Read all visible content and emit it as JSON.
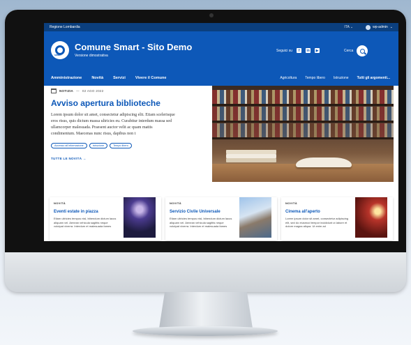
{
  "topbar": {
    "region": "Regione Lombardia",
    "lang": "ITA",
    "lang_caret": "⌄",
    "user": "wp-admin",
    "user_caret": "⌄"
  },
  "header": {
    "logo_word": "smart",
    "title": "Comune Smart - Sito Demo",
    "subtitle": "Versione dimostrativa",
    "follow": "Seguici su",
    "social": [
      "f",
      "in",
      "▶"
    ],
    "search_label": "Cerca"
  },
  "nav": {
    "primary": [
      "Amministrazione",
      "Novità",
      "Servizi",
      "Vivere il Comune"
    ],
    "secondary": [
      "Agricoltura",
      "Tempo libero",
      "Istruzione"
    ],
    "all_topics": "Tutti gli argomenti..."
  },
  "hero": {
    "kind": "NOTIZIA",
    "sep": "—",
    "date": "02 AGO 2022",
    "title": "Avviso apertura biblioteche",
    "lead": "Lorem ipsum dolor sit amet, consectetur adipiscing elit. Etiam scelerisque eros risus, quis dictum massa ultricies eu. Curabitur interdum massa sed ullamcorper malesuada. Praesent auctor velit ac quam mattis condimentum. Maecenas nunc risus, dapibus non t",
    "tags": [
      "Accesso all'informazione",
      "Istruzione",
      "Tempo libero"
    ],
    "all_news": "TUTTE LE NOVITÀ",
    "arrow": "→"
  },
  "cards": [
    {
      "kind": "NOVITÀ",
      "title": "Eventi estate in piazza",
      "text": "Etiam ultricies tempus nisl, bibendum dictum lacus aliquam vel. Aenean vehicula sagittis neque volutpat viverra. Interdum et malesuada fames"
    },
    {
      "kind": "NOVITÀ",
      "title": "Servizio Civile Universale",
      "text": "Etiam ultricies tempus nisl, bibendum dictum lacus aliquam vel. Aenean vehicula sagittis neque volutpat viverra. Interdum et malesuada fames"
    },
    {
      "kind": "NOVITÀ",
      "title": "Cinema all'aperto",
      "text": "Lorem ipsum dolor sit amet, consectetur adipiscing elit, sed do eiusmod tempor incididunt ut labore et dolore magna aliqua. Ut enim ad"
    }
  ],
  "colors": {
    "primary": "#0d58b8",
    "topbar": "#0b3f7e"
  }
}
